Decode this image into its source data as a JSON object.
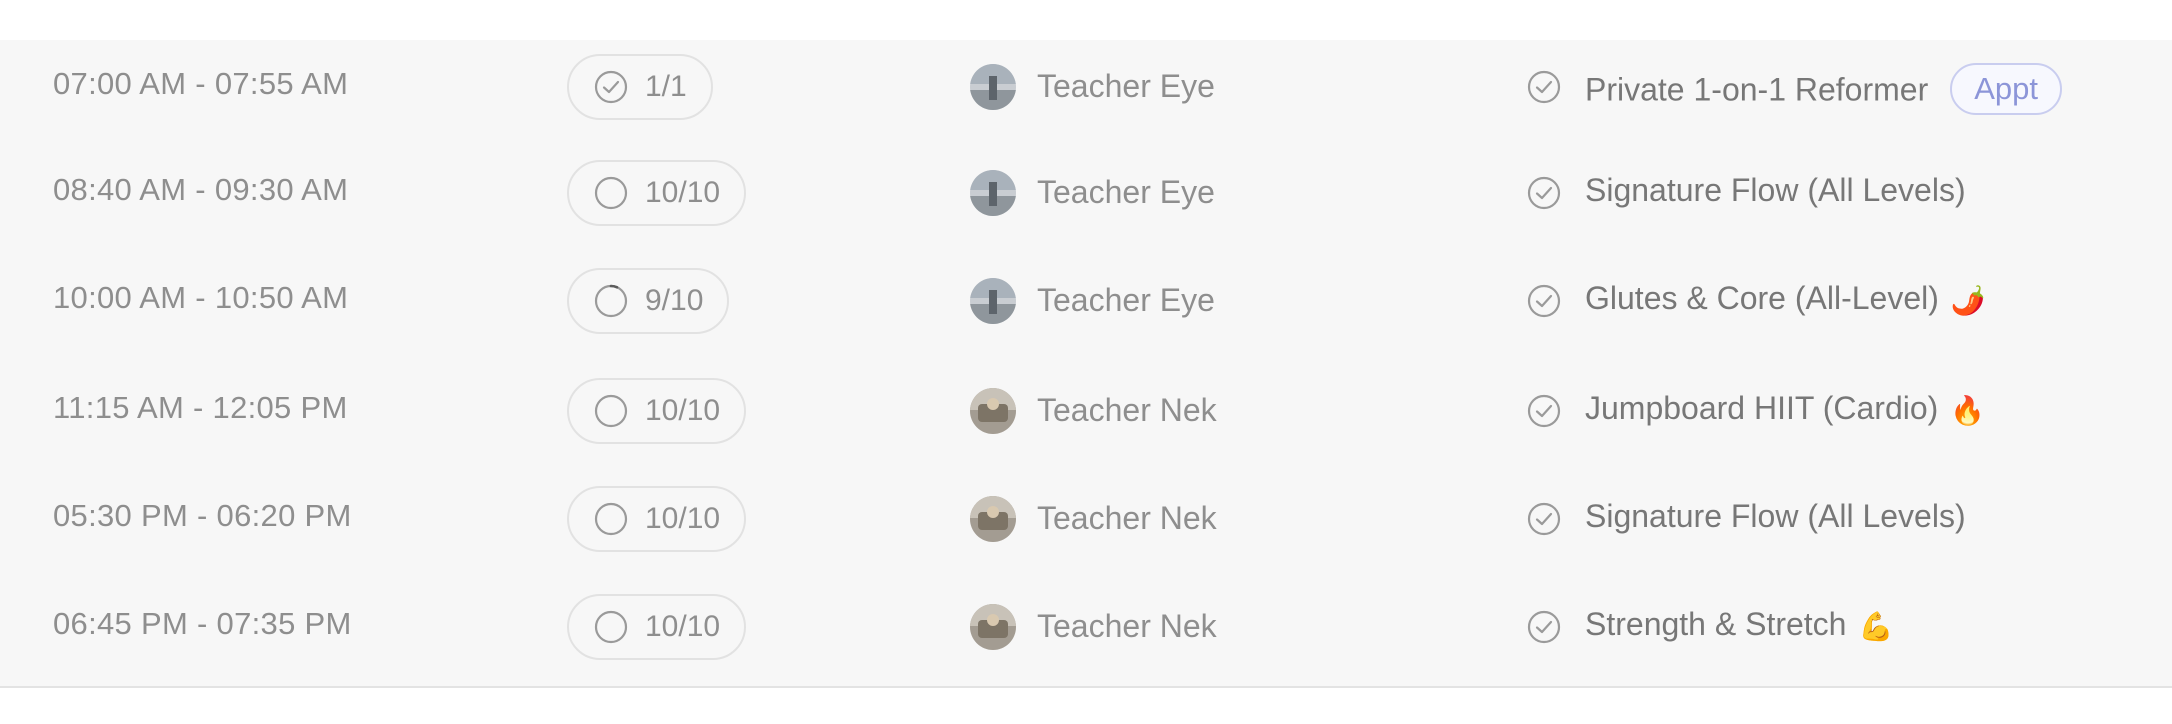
{
  "schedule": {
    "rows": [
      {
        "time": "07:00 AM - 07:55 AM",
        "capacity": "1/1",
        "capacity_icon": "check-circle-icon",
        "teacher": "Teacher Eye",
        "class_name": "Private 1-on-1 Reformer",
        "badge": "Appt",
        "emoji": ""
      },
      {
        "time": "08:40 AM - 09:30 AM",
        "capacity": "10/10",
        "capacity_icon": "empty-circle-icon",
        "teacher": "Teacher Eye",
        "class_name": "Signature Flow (All Levels)",
        "badge": "",
        "emoji": ""
      },
      {
        "time": "10:00 AM - 10:50 AM",
        "capacity": "9/10",
        "capacity_icon": "progress-circle-icon",
        "teacher": "Teacher Eye",
        "class_name": "Glutes & Core (All-Level)",
        "badge": "",
        "emoji": "🌶️"
      },
      {
        "time": "11:15 AM - 12:05 PM",
        "capacity": "10/10",
        "capacity_icon": "empty-circle-icon",
        "teacher": "Teacher Nek",
        "class_name": "Jumpboard HIIT (Cardio)",
        "badge": "",
        "emoji": "🔥"
      },
      {
        "time": "05:30 PM - 06:20 PM",
        "capacity": "10/10",
        "capacity_icon": "empty-circle-icon",
        "teacher": "Teacher Nek",
        "class_name": "Signature Flow (All Levels)",
        "badge": "",
        "emoji": ""
      },
      {
        "time": "06:45 PM - 07:35 PM",
        "capacity": "10/10",
        "capacity_icon": "empty-circle-icon",
        "teacher": "Teacher Nek",
        "class_name": "Strength & Stretch",
        "badge": "",
        "emoji": "💪"
      }
    ]
  },
  "colors": {
    "panel_background": "#f7f7f7",
    "text_muted": "#8e8e8e",
    "class_text": "#777777",
    "badge_accent": "#8c95d8"
  }
}
